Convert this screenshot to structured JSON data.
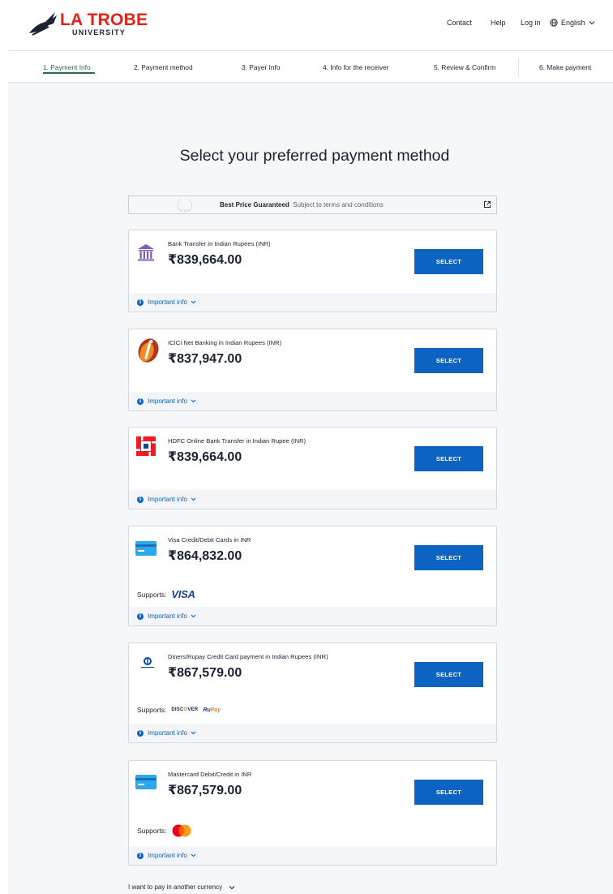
{
  "header": {
    "logo_name": "LA TROBE",
    "logo_sub": "UNIVERSITY",
    "links": {
      "contact": "Contact",
      "help": "Help",
      "login": "Log in"
    },
    "language": "English"
  },
  "stepper": {
    "steps": [
      {
        "label": "1. Payment Info",
        "active": true
      },
      {
        "label": "2. Payment method",
        "active": false
      },
      {
        "label": "3. Payer Info",
        "active": false
      },
      {
        "label": "4. Info for the receiver",
        "active": false
      },
      {
        "label": "5. Review & Confirm",
        "active": false
      },
      {
        "label": "6. Make payment",
        "active": false
      }
    ]
  },
  "main": {
    "title": "Select your preferred payment method",
    "banner": {
      "strong": "Best Price Guaranteed",
      "text": "Subject to terms and conditions"
    },
    "select_label": "SELECT",
    "important_info_label": "Important info",
    "supports_label": "Supports:",
    "methods": [
      {
        "label": "Bank Transfer in Indian Rupees (INR)",
        "amount": "₹839,664.00",
        "icon": "bank-icon"
      },
      {
        "label": "ICICI Net Banking in Indian Rupees (INR)",
        "amount": "₹837,947.00",
        "icon": "icici-logo-icon"
      },
      {
        "label": "HDFC Online Bank Transfer in Indian Rupee (INR)",
        "amount": "₹839,664.00",
        "icon": "hdfc-logo-icon"
      },
      {
        "label": "Visa Credit/Debit Cards in INR",
        "amount": "₹864,832.00",
        "icon": "card-icon",
        "supports": [
          "VISA"
        ]
      },
      {
        "label": "Diners/Rupay Credit Card payment in Indian Rupees (INR)",
        "amount": "₹867,579.00",
        "icon": "diners-club-icon",
        "supports": [
          "DISCOVER",
          "RuPay"
        ]
      },
      {
        "label": "Mastercard Debit/Credit in INR",
        "amount": "₹867,579.00",
        "icon": "card-icon",
        "supports": [
          "mastercard"
        ]
      }
    ],
    "other_currency": "I want to pay in another currency"
  },
  "colors": {
    "brand_red": "#e2231a",
    "primary_blue": "#0c63c1",
    "active_step_green": "#2a6b4b",
    "background": "#f6f7f9"
  }
}
